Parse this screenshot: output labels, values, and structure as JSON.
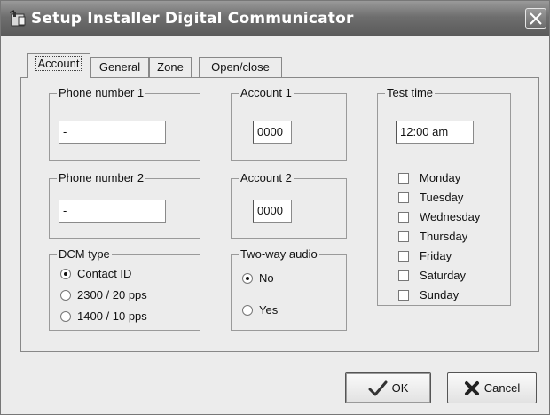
{
  "window": {
    "title": "Setup Installer Digital Communicator",
    "close_icon": "close-icon",
    "app_icon": "setup-app-icon"
  },
  "tabs": [
    {
      "label": "Account",
      "active": true
    },
    {
      "label": "General",
      "active": false
    },
    {
      "label": "Zone",
      "active": false
    },
    {
      "label": "Open/close",
      "active": false
    }
  ],
  "account": {
    "phone1": {
      "label": "Phone number 1",
      "value": "-"
    },
    "phone2": {
      "label": "Phone number 2",
      "value": "-"
    },
    "account1": {
      "label": "Account 1",
      "value": "0000"
    },
    "account2": {
      "label": "Account 2",
      "value": "0000"
    },
    "dcm_type": {
      "label": "DCM type",
      "options": [
        {
          "label": "Contact ID",
          "selected": true
        },
        {
          "label": "2300 / 20 pps",
          "selected": false
        },
        {
          "label": "1400 / 10 pps",
          "selected": false
        }
      ]
    },
    "two_way_audio": {
      "label": "Two-way audio",
      "options": [
        {
          "label": "No",
          "selected": true
        },
        {
          "label": "Yes",
          "selected": false
        }
      ]
    },
    "test_time": {
      "label": "Test time",
      "value": "12:00 am",
      "days": [
        {
          "label": "Monday",
          "checked": false
        },
        {
          "label": "Tuesday",
          "checked": false
        },
        {
          "label": "Wednesday",
          "checked": false
        },
        {
          "label": "Thursday",
          "checked": false
        },
        {
          "label": "Friday",
          "checked": false
        },
        {
          "label": "Saturday",
          "checked": false
        },
        {
          "label": "Sunday",
          "checked": false
        }
      ]
    }
  },
  "buttons": {
    "ok": "OK",
    "cancel": "Cancel",
    "ok_icon": "checkmark-icon",
    "cancel_icon": "x-cross-icon"
  }
}
